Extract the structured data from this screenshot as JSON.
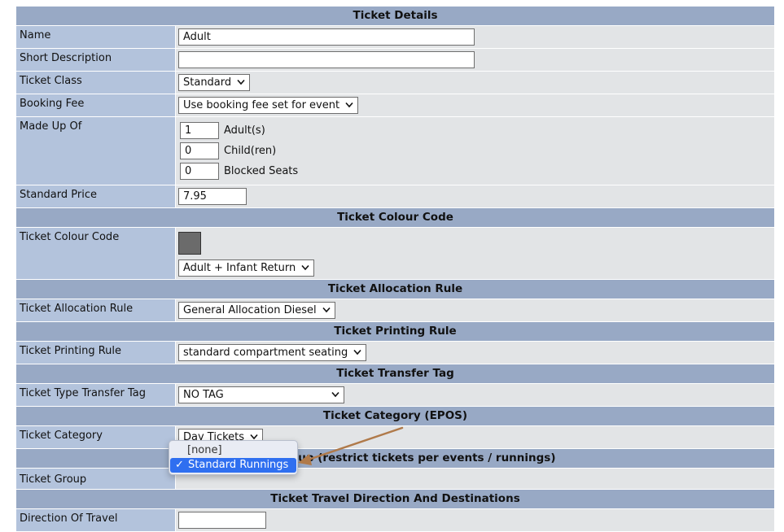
{
  "sections": {
    "ticket_details": "Ticket Details",
    "colour_code": "Ticket Colour Code",
    "allocation_rule": "Ticket Allocation Rule",
    "printing_rule": "Ticket Printing Rule",
    "transfer_tag": "Ticket Transfer Tag",
    "category_epos": "Ticket Category (EPOS)",
    "group": "Ticket Group (restrict tickets per events / runnings)",
    "travel_direction": "Ticket Travel Direction And Destinations"
  },
  "fields": {
    "name": {
      "label": "Name",
      "value": "Adult"
    },
    "short_description": {
      "label": "Short Description",
      "value": ""
    },
    "ticket_class": {
      "label": "Ticket Class",
      "value": "Standard"
    },
    "booking_fee": {
      "label": "Booking Fee",
      "value": "Use booking fee set for event"
    },
    "made_up_of": {
      "label": "Made Up Of",
      "rows": [
        {
          "value": "1",
          "unit": "Adult(s)"
        },
        {
          "value": "0",
          "unit": "Child(ren)"
        },
        {
          "value": "0",
          "unit": "Blocked Seats"
        }
      ]
    },
    "standard_price": {
      "label": "Standard Price",
      "value": "7.95"
    },
    "colour_code": {
      "label": "Ticket Colour Code",
      "swatch_color": "#6b6b6b",
      "value": "Adult + Infant Return"
    },
    "allocation_rule": {
      "label": "Ticket Allocation Rule",
      "value": "General Allocation Diesel"
    },
    "printing_rule": {
      "label": "Ticket Printing Rule",
      "value": "standard compartment seating"
    },
    "transfer_tag": {
      "label": "Ticket Type Transfer Tag",
      "value": "NO TAG"
    },
    "category": {
      "label": "Ticket Category",
      "value": "Day Tickets"
    },
    "group": {
      "label": "Ticket Group"
    },
    "direction": {
      "label": "Direction Of Travel"
    }
  },
  "group_dropdown": {
    "options": [
      {
        "label": "[none]",
        "selected": false
      },
      {
        "label": "Standard Runnings",
        "selected": true
      }
    ],
    "check_glyph": "✓"
  },
  "colors": {
    "section_bg": "#98a9c5",
    "label_bg": "#b3c3dc",
    "value_bg": "#e2e4e6",
    "selection_blue": "#2f6ff0",
    "annotation_arrow": "#b07a4a"
  }
}
